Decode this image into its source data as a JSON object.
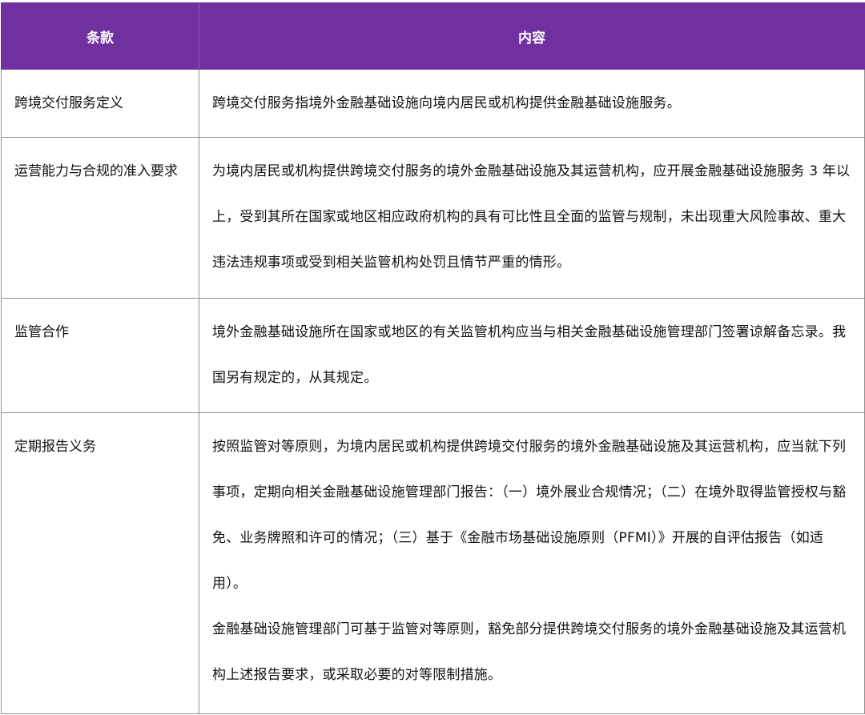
{
  "table": {
    "header": {
      "col1": "条款",
      "col2": "内容"
    },
    "rows": [
      {
        "term": "跨境交付服务定义",
        "content": [
          "跨境交付服务指境外金融基础设施向境内居民或机构提供金融基础设施服务。"
        ]
      },
      {
        "term": "运营能力与合规的准入要求",
        "content": [
          "为境内居民或机构提供跨境交付服务的境外金融基础设施及其运营机构，应开展金融基础设施服务 3 年以上，受到其所在国家或地区相应政府机构的具有可比性且全面的监管与规制，未出现重大风险事故、重大违法违规事项或受到相关监管机构处罚且情节严重的情形。"
        ]
      },
      {
        "term": "监管合作",
        "content": [
          "境外金融基础设施所在国家或地区的有关监管机构应当与相关金融基础设施管理部门签署谅解备忘录。我国另有规定的，从其规定。"
        ]
      },
      {
        "term": "定期报告义务",
        "content": [
          "按照监管对等原则，为境内居民或机构提供跨境交付服务的境外金融基础设施及其运营机构，应当就下列事项，定期向相关金融基础设施管理部门报告：（一）境外展业合规情况；（二）在境外取得监管授权与豁免、业务牌照和许可的情况；（三）基于《金融市场基础设施原则（PFMI）》开展的自评估报告（如适用）。",
          "金融基础设施管理部门可基于监管对等原则，豁免部分提供跨境交付服务的境外金融基础设施及其运营机构上述报告要求，或采取必要的对等限制措施。"
        ]
      }
    ]
  }
}
